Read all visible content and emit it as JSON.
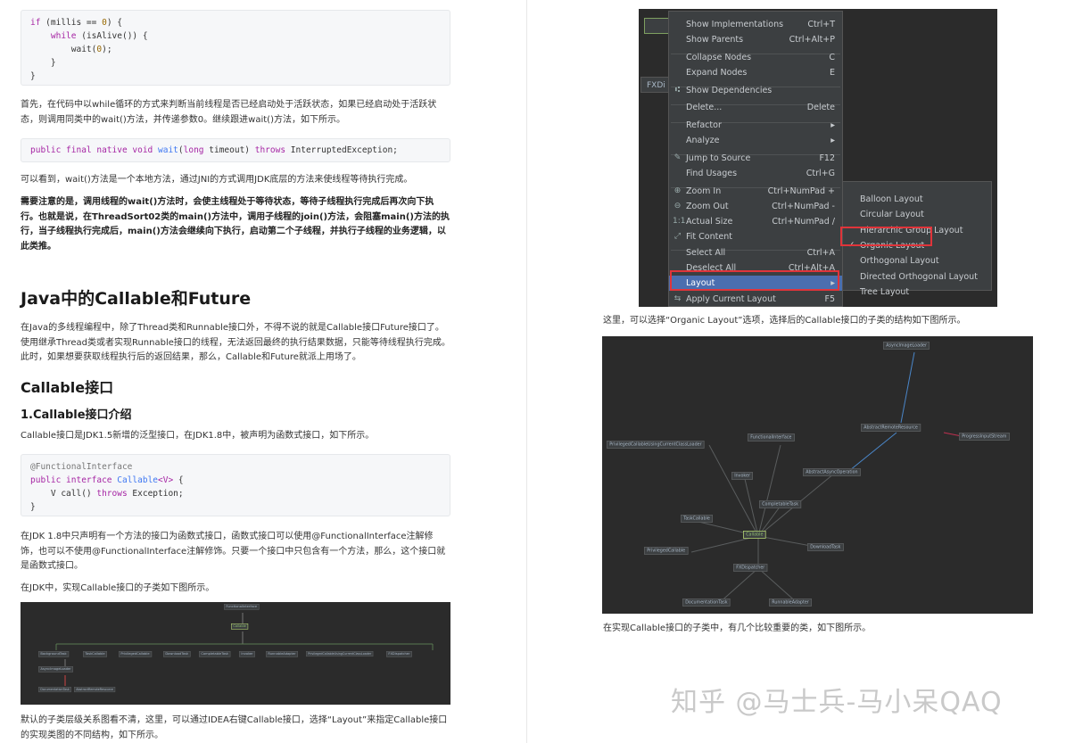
{
  "left": {
    "code1": [
      "if (millis == 0) {",
      "    while (isAlive()) {",
      "        wait(0);",
      "    }",
      "}"
    ],
    "para1": "首先，在代码中以while循环的方式来判断当前线程是否已经启动处于活跃状态，如果已经启动处于活跃状态，则调用同类中的wait()方法，并传递参数0。继续跟进wait()方法，如下所示。",
    "code2": "public final native void wait(long timeout) throws InterruptedException;",
    "para2": "可以看到，wait()方法是一个本地方法，通过JNI的方式调用JDK底层的方法来使线程等待执行完成。",
    "para3": "需要注意的是，调用线程的wait()方法时，会使主线程处于等待状态，等待子线程执行完成后再次向下执行。也就是说，在ThreadSort02类的main()方法中，调用子线程的join()方法，会阻塞main()方法的执行，当子线程执行完成后，main()方法会继续向下执行，启动第二个子线程，并执行子线程的业务逻辑，以此类推。",
    "h2": "Java中的Callable和Future",
    "para4": "在Java的多线程编程中，除了Thread类和Runnable接口外，不得不说的就是Callable接口Future接口了。使用继承Thread类或者实现Runnable接口的线程，无法返回最终的执行结果数据，只能等待线程执行完成。此时，如果想要获取线程执行后的返回结果，那么，Callable和Future就派上用场了。",
    "h3": "Callable接口",
    "h4": "1.Callable接口介绍",
    "para5": "Callable接口是JDK1.5新增的泛型接口，在JDK1.8中，被声明为函数式接口，如下所示。",
    "code3": [
      "@FunctionalInterface",
      "public interface Callable<V> {",
      "    V call() throws Exception;",
      "}"
    ],
    "para6": "在JDK 1.8中只声明有一个方法的接口为函数式接口，函数式接口可以使用@FunctionalInterface注解修饰，也可以不使用@FunctionalInterface注解修饰。只要一个接口中只包含有一个方法，那么，这个接口就是函数式接口。",
    "para7": "在JDK中，实现Callable接口的子类如下图所示。",
    "para8": "默认的子类层级关系图看不清，这里，可以通过IDEA右键Callable接口，选择“Layout”来指定Callable接口的实现类图的不同结构，如下所示。"
  },
  "right": {
    "menu_items": [
      {
        "label": "Show Implementations",
        "shortcut": "Ctrl+T"
      },
      {
        "label": "Show Parents",
        "shortcut": "Ctrl+Alt+P"
      },
      {
        "label": "Collapse Nodes",
        "shortcut": "C"
      },
      {
        "label": "Expand Nodes",
        "shortcut": "E"
      },
      {
        "label": "Show Dependencies",
        "shortcut": ""
      },
      {
        "label": "Delete...",
        "shortcut": "Delete"
      },
      {
        "label": "Refactor",
        "shortcut": "▸"
      },
      {
        "label": "Analyze",
        "shortcut": "▸"
      },
      {
        "label": "Jump to Source",
        "shortcut": "F12"
      },
      {
        "label": "Find Usages",
        "shortcut": "Ctrl+G"
      },
      {
        "label": "Zoom In",
        "shortcut": "Ctrl+NumPad +"
      },
      {
        "label": "Zoom Out",
        "shortcut": "Ctrl+NumPad -"
      },
      {
        "label": "Actual Size",
        "shortcut": "Ctrl+NumPad /"
      },
      {
        "label": "Fit Content",
        "shortcut": ""
      },
      {
        "label": "Select All",
        "shortcut": "Ctrl+A"
      },
      {
        "label": "Deselect All",
        "shortcut": "Ctrl+Alt+A"
      },
      {
        "label": "Layout",
        "shortcut": "▸"
      },
      {
        "label": "Apply Current Layout",
        "shortcut": "F5"
      }
    ],
    "submenu_items": [
      "Balloon Layout",
      "Circular Layout",
      "Hierarchic Group Layout",
      "Organic Layout",
      "Orthogonal Layout",
      "Directed Orthogonal Layout",
      "Tree Layout"
    ],
    "side_fragment": "FXDi",
    "para1": "这里，可以选择“Organic Layout”选项，选择后的Callable接口的子类的结构如下图所示。",
    "para2": "在实现Callable接口的子类中，有几个比较重要的类，如下图所示。",
    "graph_nodes": [
      "AsyncImageLoader",
      "AbstractRemoteResource",
      "ProgressInputStream",
      "PrivilegedCallableUsingCurrentClassLoader",
      "FunctionalInterface",
      "AbstractAsyncOperation",
      "Invoker",
      "CompletableTask",
      "TaskCallable",
      "Callable",
      "PrivilegedCallable",
      "DownloadTask",
      "FXDispatcher",
      "DocumentationTask",
      "RunnableAdapter"
    ],
    "watermark": "知乎 @马士兵-马小呆QAQ"
  },
  "small_graph": {
    "nodes": [
      "FunctionalInterface",
      "Callable",
      "BackgroundTask",
      "TaskCallable",
      "PrivilegedCallable",
      "DownloadTask",
      "CompletableTask",
      "Invoker",
      "RunnableAdapter",
      "PrivilegedCallableUsingCurrentClassLoader",
      "FXDispatcher",
      "AsyncImageLoader",
      "DocumentationTask",
      "AbstractRemoteResource",
      "ProgressInputStream",
      "AbstractAsyncOperation"
    ]
  }
}
